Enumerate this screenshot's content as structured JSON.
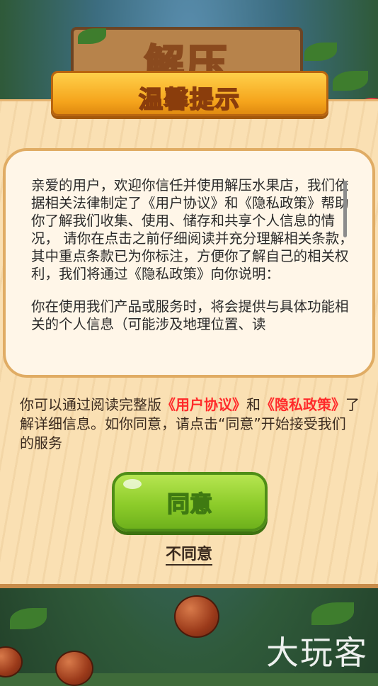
{
  "background": {
    "sign_text": "解压"
  },
  "dialog": {
    "title": "温馨提示",
    "body_paragraph_1": "亲爱的用户，欢迎你信任并使用解压水果店，我们依据相关法律制定了《用户协议》和《隐私政策》帮助你了解我们收集、使用、储存和共享个人信息的情况， 请你在点击之前仔细阅读并充分理解相关条款，其中重点条款已为你标注，方便你了解自己的相关权利，我们将通过《隐私政策》向你说明：",
    "body_paragraph_2": "你在使用我们产品或服务时，将会提供与具体功能相关的个人信息（可能涉及地理位置、读",
    "notice_prefix": "你可以通过阅读完整版",
    "notice_link_agreement": "《用户协议》",
    "notice_and": "和",
    "notice_link_privacy": "《隐私政策》",
    "notice_suffix": "了解详细信息。如你同意，请点击“同意”开始接受我们的服务",
    "agree_label": "同意",
    "disagree_label": "不同意"
  },
  "watermark": "大玩客",
  "colors": {
    "link_red": "#ff2a2a",
    "agree_green": "#8dcc2a",
    "banner_orange": "#f5a41c",
    "panel_cream": "#fff6e8"
  }
}
